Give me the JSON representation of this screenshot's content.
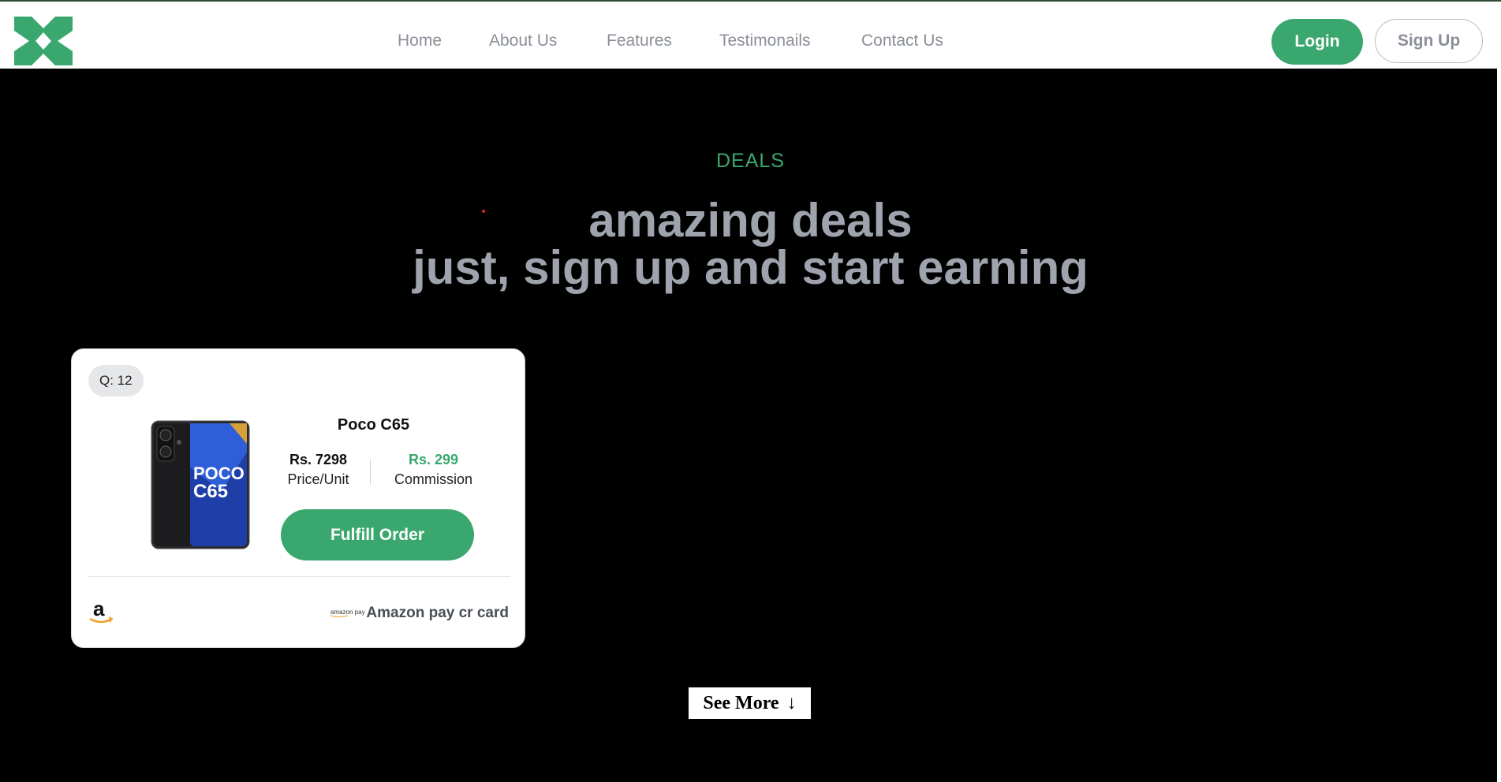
{
  "nav": {
    "links": [
      "Home",
      "About Us",
      "Features",
      "Testimonails",
      "Contact Us"
    ],
    "login_label": "Login",
    "signup_label": "Sign Up"
  },
  "hero": {
    "eyebrow": "DEALS",
    "headline_line1": "amazing deals",
    "headline_line2": "just, sign up and start earning"
  },
  "deal_card": {
    "quantity": "Q: 12",
    "product_name": "Poco C65",
    "product_image_text": [
      "POCO",
      "C65"
    ],
    "price": "Rs. 7298",
    "price_label": "Price/Unit",
    "commission": "Rs. 299",
    "commission_label": "Commission",
    "cta_label": "Fulfill Order",
    "store_icon": "amazon-logo-icon",
    "payment_icon_text": "amazon pay",
    "payment_method": "Amazon pay cr card"
  },
  "see_more": {
    "label": "See More",
    "arrow": "↓"
  },
  "colors": {
    "brand_green": "#3aa86e",
    "muted_gray": "#9ea3ad",
    "background": "#000000"
  }
}
